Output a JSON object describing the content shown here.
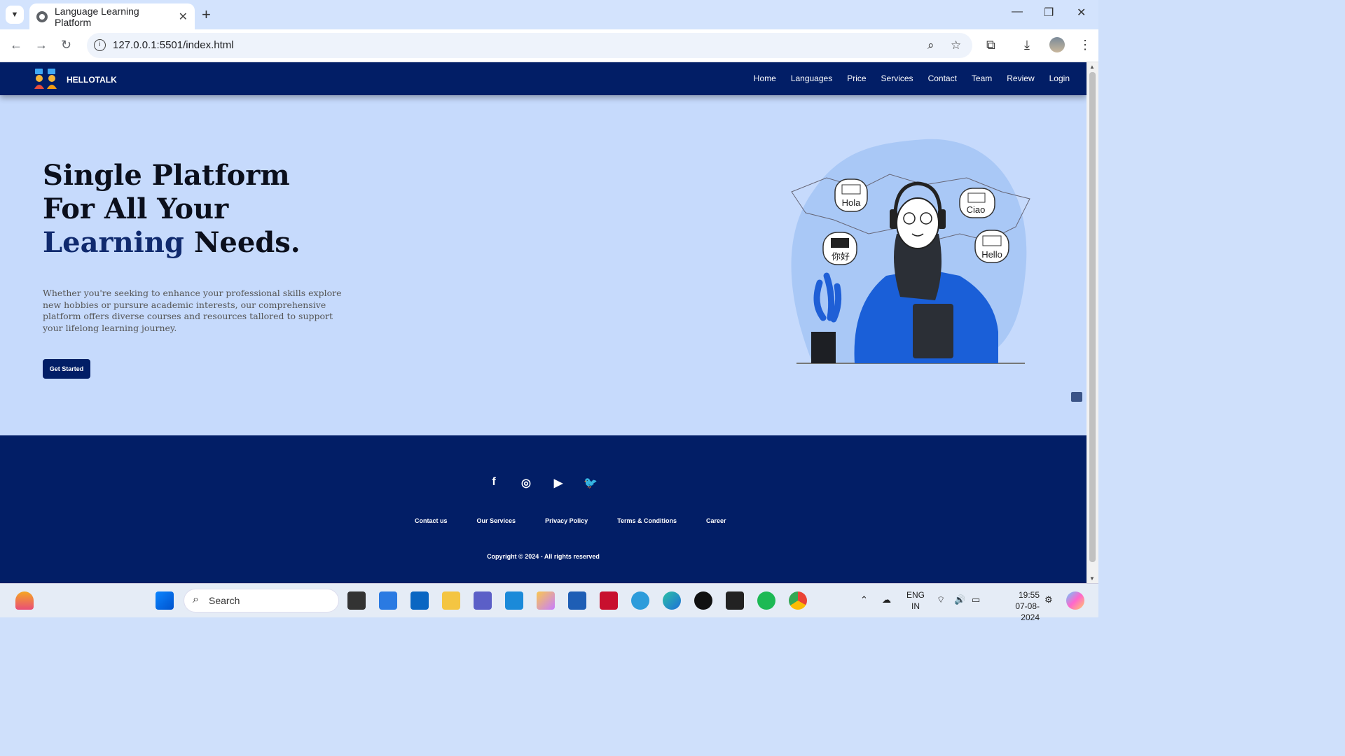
{
  "browser": {
    "tab_title": "Language Learning Platform",
    "url": "127.0.0.1:5501/index.html"
  },
  "nav": {
    "brand": "HELLOTALK",
    "items": [
      "Home",
      "Languages",
      "Price",
      "Services",
      "Contact",
      "Team",
      "Review",
      "Login"
    ]
  },
  "hero": {
    "title_line1": "Single Platform",
    "title_line2": "For All Your",
    "title_accent": "Learning",
    "title_end": " Needs.",
    "description": "Whether you're seeking to enhance your professional skills explore new hobbies or pursure academic interests, our comprehensive platform offers diverse courses and resources tallored to support your lifelong learning journey.",
    "cta": "Get Started",
    "bubbles": [
      "Hola",
      "Ciao",
      "你好",
      "Hello"
    ]
  },
  "footer": {
    "social": [
      "facebook-icon",
      "instagram-icon",
      "youtube-icon",
      "twitter-icon"
    ],
    "links": [
      "Contact us",
      "Our Services",
      "Privacy Policy",
      "Terms & Conditions",
      "Career"
    ],
    "copyright": "Copyright © 2024 - All rights reserved"
  },
  "taskbar": {
    "search_placeholder": "Search",
    "lang_top": "ENG",
    "lang_bottom": "IN",
    "time": "19:55",
    "date": "07-08-2024"
  },
  "colors": {
    "navy": "#021e66",
    "page_bg": "#c6dafc",
    "accent_text": "#102a6e"
  }
}
